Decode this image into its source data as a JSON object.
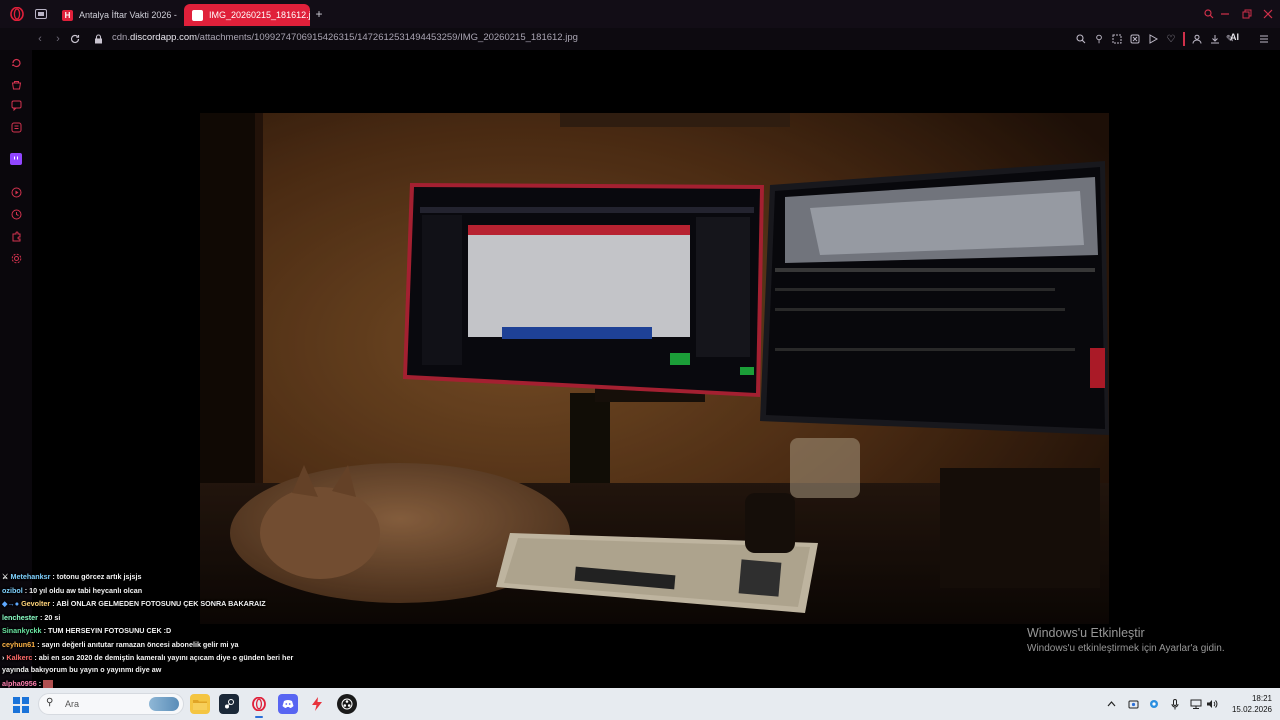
{
  "browser": {
    "tabs": [
      {
        "label": "Antalya İftar Vakti 2026 - A",
        "active": false
      },
      {
        "label": "IMG_20260215_181612.jpg",
        "active": true
      }
    ],
    "new_tab_label": "+",
    "url_prefix": "cdn.",
    "url_domain": "discordapp.com",
    "url_path": "/attachments/1099274706915426315/1472612531494453259/IMG_20260215_181612.jpg",
    "ai_label": "AI"
  },
  "photo_screens": {
    "left_monitor_app_title": "GüvenBulut",
    "right_monitor_channel": "Fanatıki",
    "right_monitor_video_title": "TOYOTA EN BASIT SORUNUNUZ ŞANZIMANI BULDU | 4-CVT",
    "right_monitor_side_label": "Rock"
  },
  "chat": {
    "messages": [
      {
        "user": "Metehanksr",
        "text": "totonu görcez artık jsjsjs",
        "color": "#7fd1ff",
        "badge": "⚔"
      },
      {
        "user": "ozibol",
        "text": "10 yıl oldu aw tabi heycanlı olcan",
        "color": "#7fd1ff",
        "badge": ""
      },
      {
        "user": "Gevolter",
        "text": "ABİ ONLAR GELMEDEN FOTOSUNU ÇEK SONRA BAKARAIZ",
        "color": "#ffd37a",
        "badge": "◆→●"
      },
      {
        "user": "lenchester",
        "text": "20 si",
        "color": "#8cffc8",
        "badge": ""
      },
      {
        "user": "Sinankyckk",
        "text": "TUM HERSEYIN FOTOSUNU CEK :D",
        "color": "#69e3a0",
        "badge": ""
      },
      {
        "user": "ceyhun61",
        "text": "sayın değerli anıtutar ramazan öncesi abonelik gelir mi ya",
        "color": "#ffb347",
        "badge": ""
      },
      {
        "user": "Kalkerc",
        "text": "abi en son 2020 de demiştin kameralı yayını açıcam diye o günden beri her yayında bakıyorum bu yayın o yayınmı diye aw",
        "color": "#ff6a6a",
        "badge": "›"
      },
      {
        "user": "alpha0956",
        "text": "",
        "color": "#ff7fb0",
        "badge": ""
      }
    ]
  },
  "watermark": {
    "title": "Windows'u Etkinleştir",
    "subtitle": "Windows'u etkinleştirmek için Ayarlar'a gidin."
  },
  "taskbar": {
    "search_placeholder": "Ara",
    "time": "18:21",
    "date": "15.02.2026"
  }
}
